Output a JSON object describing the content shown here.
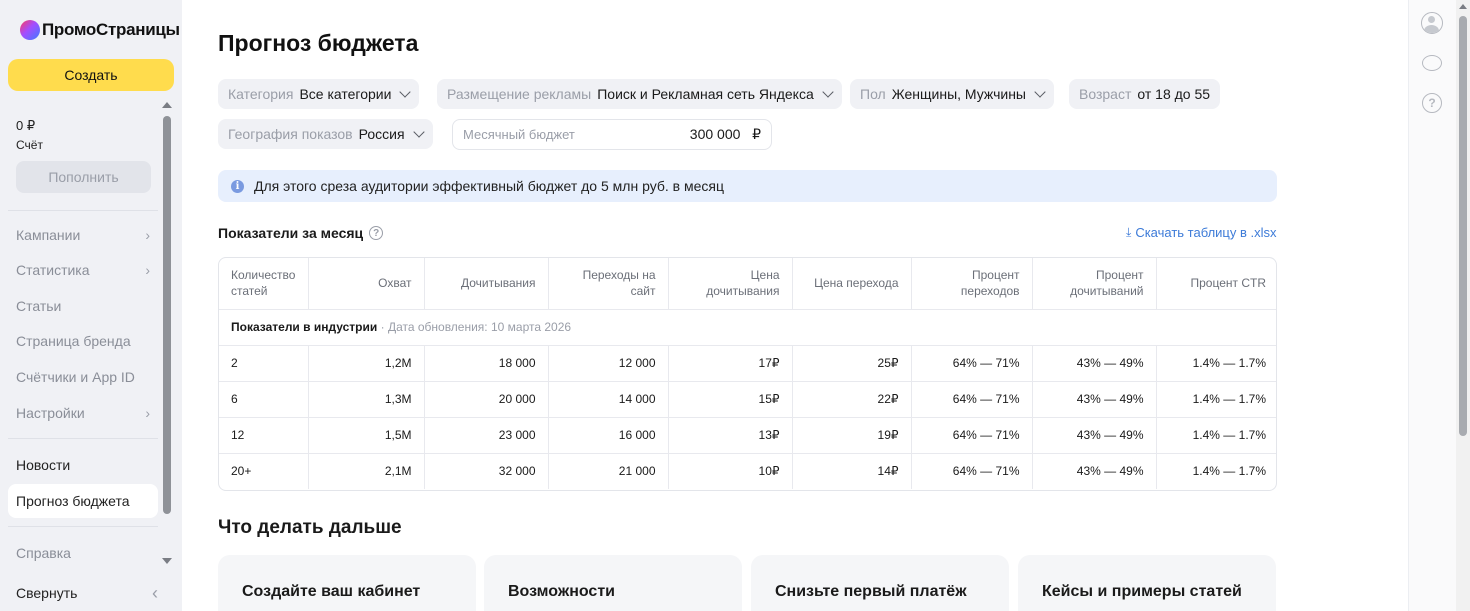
{
  "sidebar": {
    "logo_text": "ПромоСтраницы",
    "create_label": "Создать",
    "balance": "0 ₽",
    "balance_label": "Счёт",
    "topup_label": "Пополнить",
    "items": [
      {
        "label": "Кампании",
        "chevron": "›"
      },
      {
        "label": "Статистика",
        "chevron": "›"
      },
      {
        "label": "Статьи"
      },
      {
        "label": "Страница бренда"
      },
      {
        "label": "Счётчики и App ID"
      },
      {
        "label": "Настройки",
        "chevron": "›"
      },
      {
        "label": "Новости"
      },
      {
        "label": "Прогноз бюджета"
      },
      {
        "label": "Справка"
      }
    ],
    "collapse_label": "Свернуть",
    "collapse_chevron": "‹"
  },
  "main": {
    "title": "Прогноз бюджета",
    "filters": {
      "category": {
        "label": "Категория",
        "value": "Все категории"
      },
      "placement": {
        "label": "Размещение рекламы",
        "value": "Поиск и Рекламная сеть Яндекса"
      },
      "gender": {
        "label": "Пол",
        "value": "Женщины, Мужчины"
      },
      "age": {
        "label": "Возраст",
        "value": "от 18 до 55"
      },
      "geo": {
        "label": "География показов",
        "value": "Россия"
      }
    },
    "budget": {
      "placeholder": "Месячный бюджет",
      "value": "300 000",
      "currency": "₽"
    },
    "info": {
      "icon": "i",
      "text": "Для этого среза аудитории эффективный бюджет до 5 млн руб. в месяц"
    },
    "section_title": "Показатели за месяц",
    "help_glyph": "?",
    "download": {
      "icon": "⤓",
      "label": "Скачать таблицу в .xlsx"
    },
    "table": {
      "headers": [
        "Количество статей",
        "Охват",
        "Дочитывания",
        "Переходы на сайт",
        "Цена дочитывания",
        "Цена перехода",
        "Процент переходов",
        "Процент дочитываний",
        "Процент CTR"
      ],
      "industry_label": "Показатели в индустрии",
      "industry_sep": " · ",
      "industry_note": "Дата обновления: 10 марта 2026",
      "rows": [
        [
          "2",
          "1,2M",
          "18 000",
          "12 000",
          "17₽",
          "25₽",
          "64% — 71%",
          "43% — 49%",
          "1.4% — 1.7%"
        ],
        [
          "6",
          "1,3M",
          "20 000",
          "14 000",
          "15₽",
          "22₽",
          "64% — 71%",
          "43% — 49%",
          "1.4% — 1.7%"
        ],
        [
          "12",
          "1,5M",
          "23 000",
          "16 000",
          "13₽",
          "19₽",
          "64% — 71%",
          "43% — 49%",
          "1.4% — 1.7%"
        ],
        [
          "20+",
          "2,1M",
          "32 000",
          "21 000",
          "10₽",
          "14₽",
          "64% — 71%",
          "43% — 49%",
          "1.4% — 1.7%"
        ]
      ]
    },
    "next_title": "Что делать дальше",
    "cards": [
      "Создайте ваш кабинет",
      "Возможности оптимизации",
      "Снизьте первый платёж",
      "Кейсы и примеры статей"
    ]
  },
  "rail": {
    "help_glyph": "?"
  },
  "colors": {
    "accent_yellow": "#ffdc4d",
    "link_blue": "#3d7bd8",
    "info_bg": "#e7effd",
    "sidebar_bg": "#f0f1f5"
  }
}
